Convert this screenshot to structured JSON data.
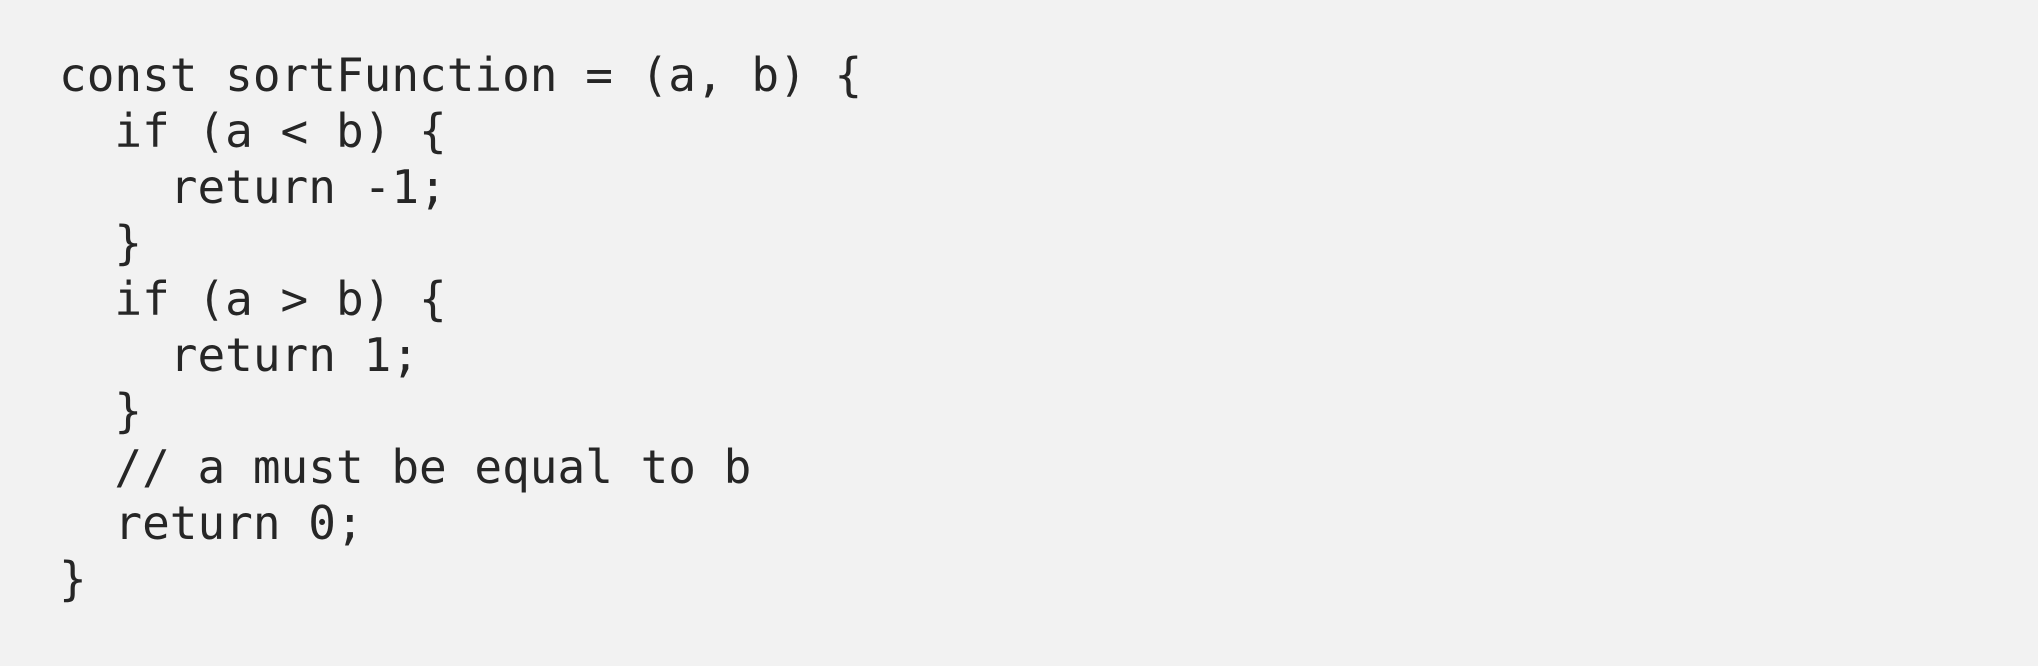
{
  "code": {
    "lines": [
      "const sortFunction = (a, b) {",
      "  if (a < b) {",
      "    return -1;",
      "  }",
      "  if (a > b) {",
      "    return 1;",
      "  }",
      "  // a must be equal to b",
      "  return 0;",
      "}"
    ]
  }
}
